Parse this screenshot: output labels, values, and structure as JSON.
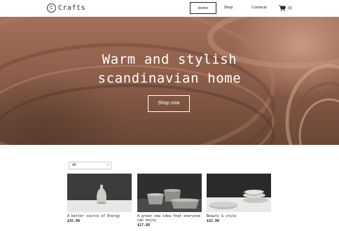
{
  "brand": {
    "logo_mark": "C",
    "name": "Crafts"
  },
  "nav": {
    "items": [
      {
        "label": "Home",
        "active": true
      },
      {
        "label": "Shop",
        "active": false
      },
      {
        "label": "Contacts",
        "active": false
      }
    ],
    "cart_count": "(0)"
  },
  "hero": {
    "title_line1": "Warm and stylish",
    "title_line2": "scandinavian home",
    "cta_label": "Shop now"
  },
  "filter": {
    "selected": "All"
  },
  "products": [
    {
      "title": "A better source of Energy",
      "price": "$35.00",
      "icon": "vase-image"
    },
    {
      "title": "A great new idea that everyone can enjoy",
      "price": "$17.00",
      "icon": "bowls-image"
    },
    {
      "title": "Beauty & style",
      "price": "$32.00",
      "icon": "dishes-image"
    }
  ],
  "colors": {
    "hero_brown": "#8d5f4a",
    "text": "#222222",
    "border": "#cccccc"
  }
}
